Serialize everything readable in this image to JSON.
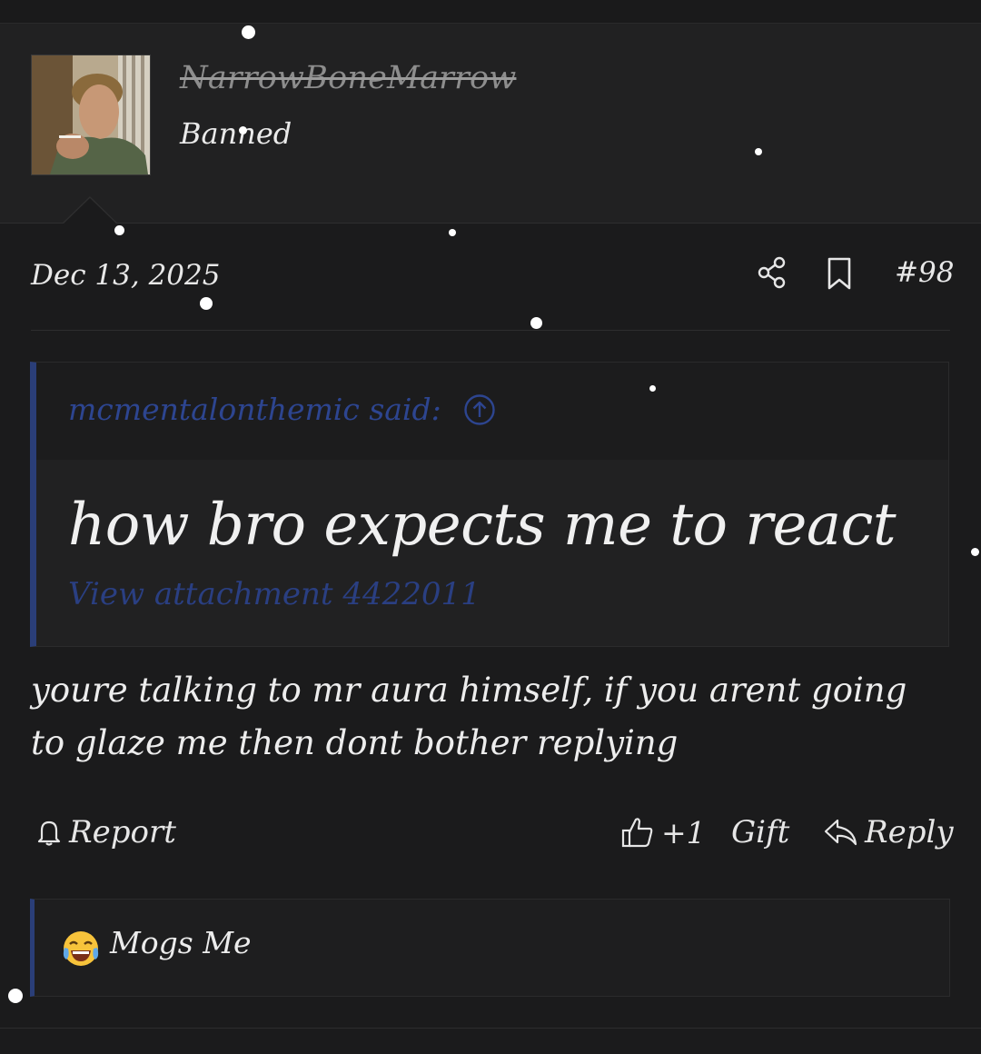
{
  "user": {
    "username": "NarrowBoneMarrow",
    "title": "Banned"
  },
  "post": {
    "date": "Dec 13, 2025",
    "number": "#98",
    "quote": {
      "attribution": "mcmentalonthemic said:",
      "text": "how bro expects me to react",
      "attachment": "View attachment 4422011"
    },
    "body": "youre talking to mr aura himself, if you arent going to glaze me then dont bother replying"
  },
  "actions": {
    "report": "Report",
    "like_count": "+1",
    "gift": "Gift",
    "reply": "Reply"
  },
  "reactions": {
    "emoji": "joy-emoji",
    "label": "Mogs Me"
  },
  "colors": {
    "background": "#1b1b1c",
    "panel": "#212122",
    "accent_blue": "#2a3e78",
    "link_blue": "#2d4590",
    "text": "#e6e6e6"
  },
  "icons": {
    "share": "share-icon",
    "bookmark": "bookmark-icon",
    "quote_jump": "arrow-up-circle-icon",
    "report": "bell-icon",
    "like": "thumbs-up-icon",
    "reply": "reply-arrow-icon"
  }
}
